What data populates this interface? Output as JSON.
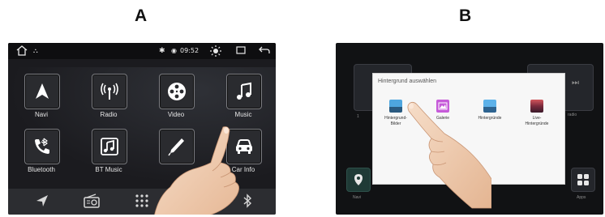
{
  "labels": {
    "a": "A",
    "b": "B"
  },
  "panelA": {
    "status": {
      "time": "09:52"
    },
    "apps": [
      {
        "label": "Navi",
        "icon": "navigation-arrow-icon"
      },
      {
        "label": "Radio",
        "icon": "radio-antenna-icon"
      },
      {
        "label": "Video",
        "icon": "film-reel-icon"
      },
      {
        "label": "Music",
        "icon": "music-note-icon"
      },
      {
        "label": "Bluetooth",
        "icon": "bluetooth-phone-icon"
      },
      {
        "label": "BT Music",
        "icon": "bt-music-icon"
      },
      {
        "label": "",
        "icon": "pen-icon"
      },
      {
        "label": "Car Info",
        "icon": "car-icon"
      }
    ],
    "dock": [
      "navigation-icon",
      "radio-icon",
      "grid-icon",
      "bluetooth-icon"
    ]
  },
  "panelB": {
    "dialog_title": "Hintergrund auswählen",
    "options": [
      {
        "label_line1": "Hintergrund-",
        "label_line2": "Bilder"
      },
      {
        "label_line1": "Galerie",
        "label_line2": ""
      },
      {
        "label_line1": "Hintergründe",
        "label_line2": ""
      },
      {
        "label_line1": "Live-",
        "label_line2": "Hintergründe"
      }
    ],
    "side_left": "Navi",
    "side_right": "Apps",
    "side_right_partial": "radio"
  },
  "colors": {
    "accent": "#2aa3e0"
  }
}
